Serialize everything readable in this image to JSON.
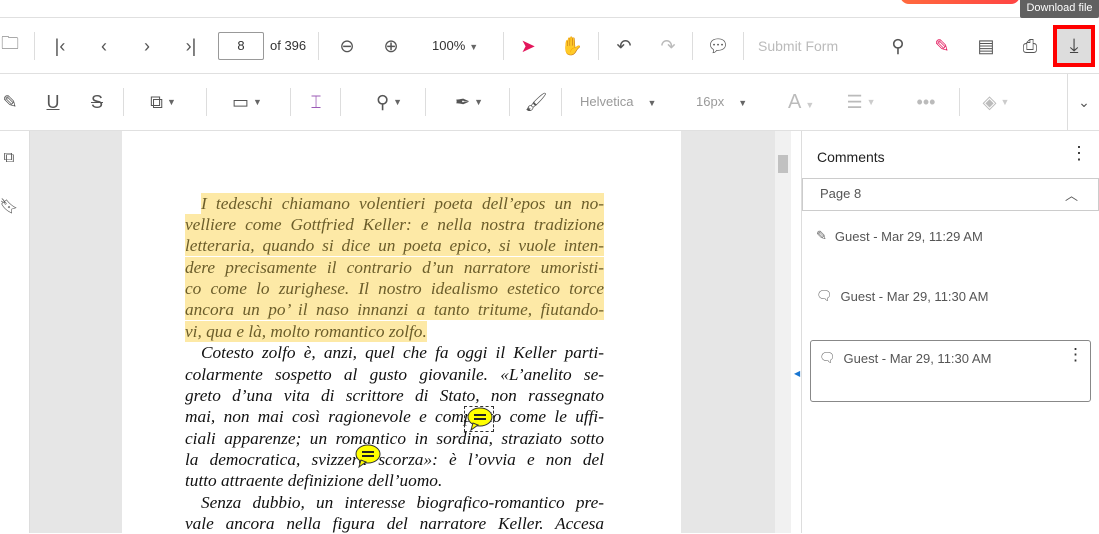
{
  "tooltip": "Download file",
  "toolbar": {
    "page_value": "8",
    "page_total": "of 396",
    "zoom": "100%",
    "submit_form": "Submit Form"
  },
  "format_toolbar": {
    "font": "Helvetica",
    "size": "16px",
    "font_color": "A"
  },
  "colors": {
    "accent": "#e3165b",
    "highlight": "#fde9a6",
    "download_outline": "#ff0000",
    "sticky_note": "#ffff00"
  },
  "document": {
    "lines": [
      {
        "text": "I tedeschi chiamano volentieri poeta dell’epos un no-",
        "highlight": true,
        "indent": true
      },
      {
        "text": "velliere come Gottfried Keller: e nella nostra tradizione",
        "highlight": true
      },
      {
        "text": "letteraria, quando si dice un poeta epico, si vuole inten-",
        "highlight": true
      },
      {
        "text": "dere precisamente il contrario d’un narratore umoristi-",
        "highlight": true
      },
      {
        "text": "co come lo zurighese. Il nostro idealismo estetico torce",
        "highlight": true
      },
      {
        "text": "ancora un po’ il naso innanzi a tanto tritume, fiutando-",
        "highlight": true
      },
      {
        "text": "vi, qua e là, molto romantico zolfo.",
        "highlight": true,
        "last": true
      },
      {
        "text": "Cotesto zolfo è, anzi, quel che fa oggi il Keller parti-",
        "indent": true
      },
      {
        "text": "colarmente sospetto al gusto giovanile. «L’anelito se-"
      },
      {
        "text": "greto d’una vita di scrittore di Stato, non rassegnato"
      },
      {
        "text": "mai, non mai così ragionevole e composto come le uffi-"
      },
      {
        "text": "ciali apparenze; un romantico in sordina, straziato sotto"
      },
      {
        "text": "la democratica, svizzera scorza»: è l’ovvia e non del"
      },
      {
        "text": "tutto attraente definizione dell’uomo.",
        "last": true
      },
      {
        "text": "Senza dubbio, un interesse biografico-romantico pre-",
        "indent": true
      },
      {
        "text": "vale ancora nella figura del narratore Keller. Accesa"
      }
    ]
  },
  "comments": {
    "title": "Comments",
    "group": "Page 8",
    "items": [
      {
        "icon": "highlight-icon",
        "text": "Guest - Mar 29, 11:29 AM"
      },
      {
        "icon": "comment-icon",
        "text": "Guest - Mar 29, 11:30 AM"
      },
      {
        "icon": "comment-icon",
        "text": "Guest - Mar 29, 11:30 AM",
        "selected": true
      }
    ]
  }
}
